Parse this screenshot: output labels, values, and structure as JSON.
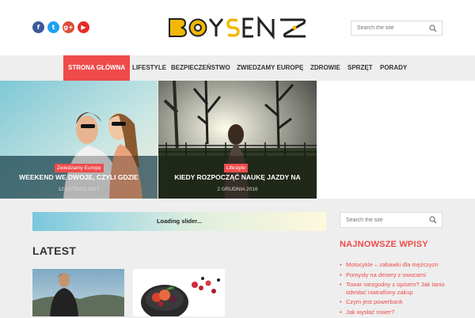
{
  "header": {
    "social_icons": [
      "facebook-icon",
      "twitter-icon",
      "google-plus-icon",
      "youtube-icon"
    ],
    "logo_text": "BOYSENZ",
    "search_placeholder": "Search the site"
  },
  "nav": {
    "items": [
      {
        "label": "STRONA GŁÓWNA",
        "active": true
      },
      {
        "label": "LIFESTYLE",
        "active": false
      },
      {
        "label": "BEZPIECZEŃSTWO",
        "active": false
      },
      {
        "label": "ZWIEDZAMY EUROPĘ",
        "active": false
      },
      {
        "label": "ZDROWIE",
        "active": false
      },
      {
        "label": "SPRZĘT",
        "active": false
      },
      {
        "label": "PORADY",
        "active": false
      }
    ]
  },
  "hero": [
    {
      "tag": "Zwiedzamy Europę",
      "title": "WEEKEND WE DWOJE, CZYLI GDZIE",
      "date": "12 LUTEGO 2017"
    },
    {
      "tag": "Lifestyle",
      "title": "KIEDY ROZPOCZĄĆ NAUKĘ JAZDY NA",
      "date": "2 GRUDNIA 2016"
    }
  ],
  "slider": {
    "loading_text": "Loading slider..."
  },
  "latest": {
    "heading": "LATEST"
  },
  "sidebar": {
    "search_placeholder": "Search the site",
    "widget_title": "NAJNOWSZE WPISY",
    "recent_posts": [
      "Motocykle – zabawki dla mężczyzn",
      "Pomysły na desery z owocami",
      "Towar niezgodny z opisem? Jak tanio odesłać niatrafiony zakup",
      "Czym jest powerbank",
      "Jak wysłać rower?"
    ]
  },
  "colors": {
    "accent": "#ef4b4b",
    "logo_yellow": "#f2b707",
    "dark": "#333333"
  }
}
